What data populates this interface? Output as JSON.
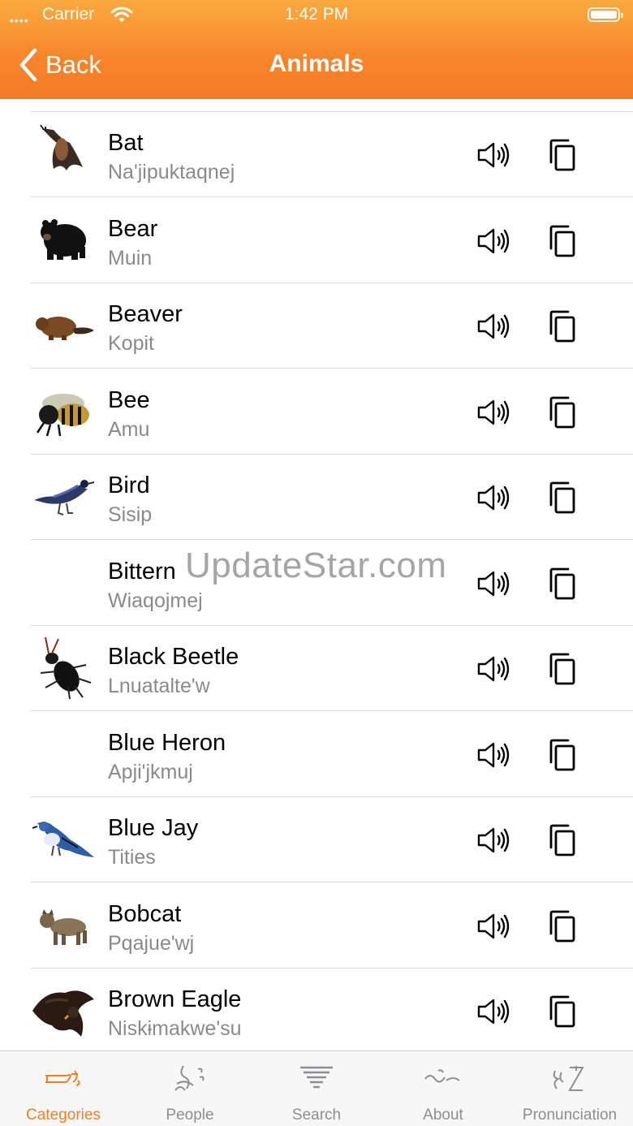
{
  "status_bar": {
    "carrier": "Carrier",
    "time": "1:42 PM"
  },
  "nav": {
    "back_label": "Back",
    "title": "Animals"
  },
  "watermark": "UpdateStar.com",
  "animals": [
    {
      "name": "Bat",
      "translation": "Na'jipuktaqnej",
      "thumbnail": "bat"
    },
    {
      "name": "Bear",
      "translation": "Muin",
      "thumbnail": "bear"
    },
    {
      "name": "Beaver",
      "translation": "Kopit",
      "thumbnail": "beaver"
    },
    {
      "name": "Bee",
      "translation": "Amu",
      "thumbnail": "bee"
    },
    {
      "name": "Bird",
      "translation": "Sisip",
      "thumbnail": "bird"
    },
    {
      "name": "Bittern",
      "translation": "Wiaqojmej",
      "thumbnail": "none"
    },
    {
      "name": "Black Beetle",
      "translation": "Lnuatalte'w",
      "thumbnail": "beetle"
    },
    {
      "name": "Blue Heron",
      "translation": "Apji'jkmuj",
      "thumbnail": "none"
    },
    {
      "name": "Blue Jay",
      "translation": "Tities",
      "thumbnail": "bluejay"
    },
    {
      "name": "Bobcat",
      "translation": "Pqajue'wj",
      "thumbnail": "bobcat"
    },
    {
      "name": "Brown Eagle",
      "translation": "Niskɨmakwe'su",
      "thumbnail": "eagle"
    }
  ],
  "tabs": [
    {
      "label": "Categories",
      "icon": "categories-glyph-icon",
      "active": true
    },
    {
      "label": "People",
      "icon": "people-glyph-icon",
      "active": false
    },
    {
      "label": "Search",
      "icon": "search-glyph-icon",
      "active": false
    },
    {
      "label": "About",
      "icon": "about-glyph-icon",
      "active": false
    },
    {
      "label": "Pronunciation",
      "icon": "pronunciation-glyph-icon",
      "active": false
    }
  ],
  "colors": {
    "accent": "#f47f23",
    "header_top": "#fbaa3f",
    "header_bottom": "#f47a25",
    "inactive_tab": "#8e8e93"
  }
}
